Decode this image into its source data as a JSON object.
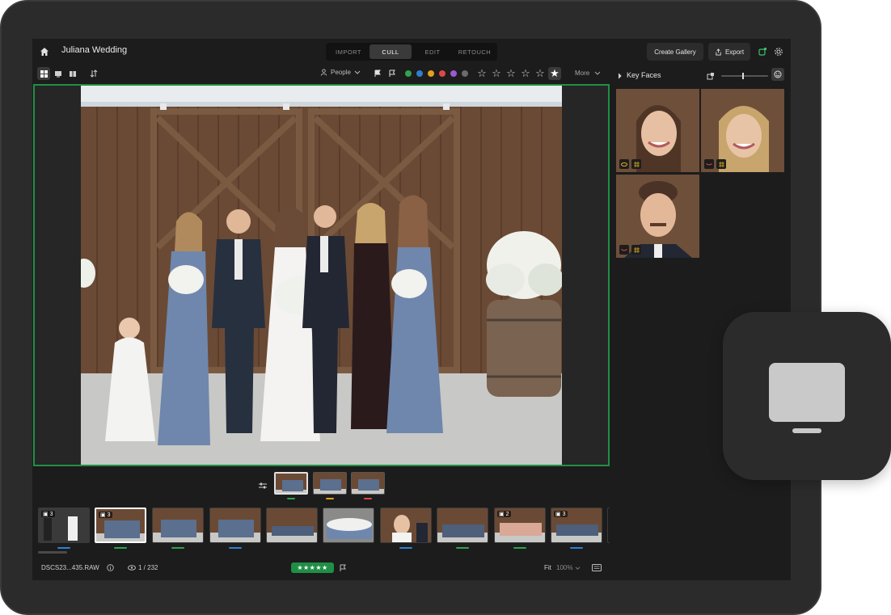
{
  "app": {
    "title": "Juliana Wedding"
  },
  "modes": [
    {
      "label": "IMPORT",
      "active": false
    },
    {
      "label": "CULL",
      "active": true
    },
    {
      "label": "EDIT",
      "active": false
    },
    {
      "label": "RETOUCH",
      "active": false
    }
  ],
  "header": {
    "create_gallery": "Create Gallery",
    "export": "Export"
  },
  "toolbar": {
    "people": "People",
    "more": "More",
    "color_labels": [
      "#2fa34f",
      "#2f7fd0",
      "#e0a020",
      "#e04848",
      "#9b59d0",
      "#6b6b6b"
    ],
    "stars": [
      "☆",
      "☆",
      "☆",
      "☆",
      "☆",
      "★"
    ]
  },
  "panel": {
    "title": "Key Faces"
  },
  "filmstrip": {
    "stack_counts": [
      "3",
      "3",
      "2",
      "3"
    ],
    "stack_marks": [
      "#2fa34f",
      "#e0a020",
      "#e04848"
    ],
    "film_marks": [
      "#2f7fd0",
      "#2fa34f",
      "#2fa34f",
      "#2f7fd0",
      "",
      "",
      "#2f7fd0",
      "#2fa34f",
      "#2fa34f",
      "#2f7fd0"
    ]
  },
  "status": {
    "filename": "DSCS23...435.RAW",
    "position": "1 / 232",
    "rating": "★★★★★",
    "fit": "Fit",
    "zoom": "100%"
  }
}
